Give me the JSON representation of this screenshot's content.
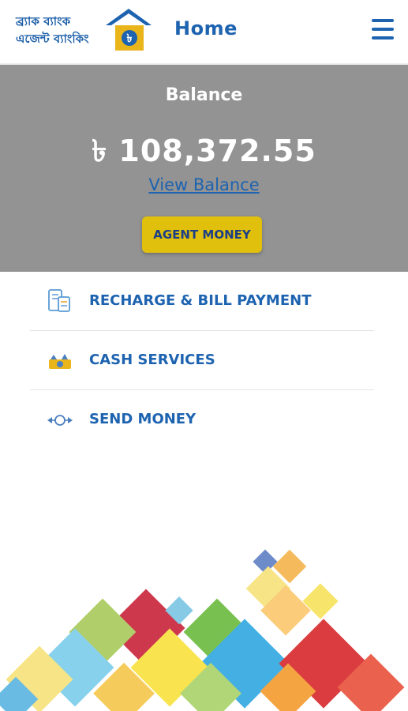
{
  "header": {
    "logo_line1": "ব্র্যাক ব্যাংক",
    "logo_line2": "এজেন্ট ব্যাংকিং",
    "title": "Home",
    "menu_icon": "hamburger-menu-icon"
  },
  "balance": {
    "label": "Balance",
    "amount": "৳ 108,372.55",
    "view_link": "View Balance",
    "agent_button": "AGENT MONEY"
  },
  "menu": {
    "items": [
      {
        "label": "RECHARGE & BILL PAYMENT",
        "icon": "recharge-bill-icon"
      },
      {
        "label": "CASH SERVICES",
        "icon": "cash-basket-icon"
      },
      {
        "label": "SEND MONEY",
        "icon": "send-money-icon"
      }
    ]
  },
  "colors": {
    "brand_blue": "#1d63b0",
    "balance_panel": "#939393",
    "agent_button": "#e0bf0d"
  }
}
